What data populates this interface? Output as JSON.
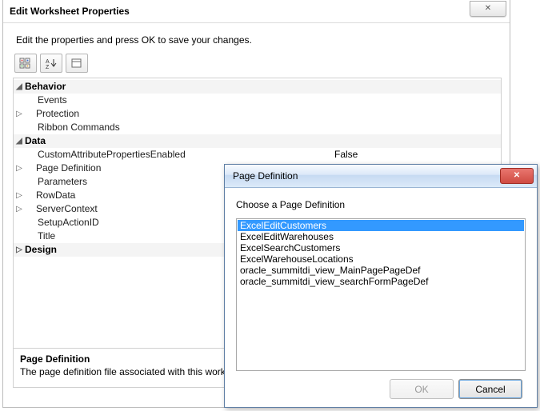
{
  "mainDialog": {
    "title": "Edit Worksheet Properties",
    "instruction": "Edit the properties and press OK to save your changes."
  },
  "toolbar": {
    "categorizedTip": "Categorized",
    "sortTip": "Alphabetical",
    "pagesTip": "Property Pages"
  },
  "grid": {
    "cat1": "Behavior",
    "cat1_items": {
      "events": "Events",
      "protection": "Protection",
      "ribbon": "Ribbon Commands"
    },
    "cat2": "Data",
    "cat2_items": {
      "custAttr": {
        "label": "CustomAttributePropertiesEnabled",
        "value": "False"
      },
      "pageDef": {
        "label": "Page Definition",
        "value": "ExcelEditCustomers"
      },
      "params": {
        "label": "Parameters",
        "value": ""
      },
      "rowData": {
        "label": "RowData",
        "value": ""
      },
      "serverCtx": {
        "label": "ServerContext",
        "value": ""
      },
      "setupAction": {
        "label": "SetupActionID",
        "value": ""
      },
      "title": {
        "label": "Title",
        "value": ""
      }
    },
    "cat3": "Design"
  },
  "description": {
    "title": "Page Definition",
    "text": "The page definition file associated with this worksheet."
  },
  "subDialog": {
    "title": "Page Definition",
    "prompt": "Choose a Page Definition",
    "items": [
      "ExcelEditCustomers",
      "ExcelEditWarehouses",
      "ExcelSearchCustomers",
      "ExcelWarehouseLocations",
      "oracle_summitdi_view_MainPagePageDef",
      "oracle_summitdi_view_searchFormPageDef"
    ],
    "ok": "OK",
    "cancel": "Cancel"
  }
}
